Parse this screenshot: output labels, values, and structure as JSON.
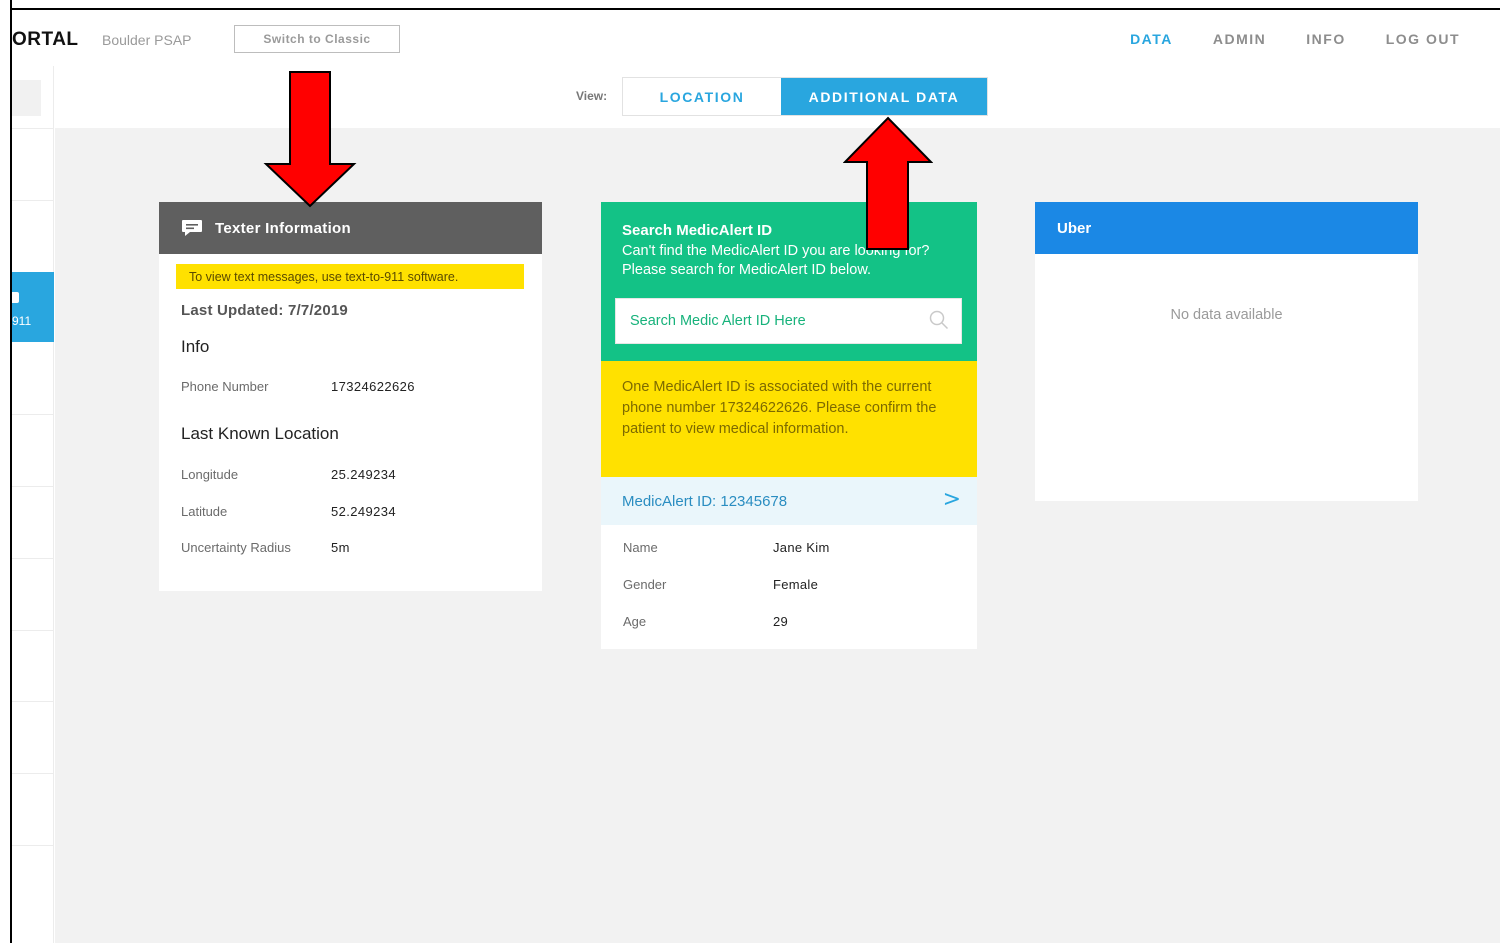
{
  "header": {
    "brand": "ORTAL",
    "psap_name": "Boulder PSAP",
    "switch_button": "Switch to Classic",
    "nav": [
      {
        "label": "DATA",
        "active": true
      },
      {
        "label": "ADMIN",
        "active": false
      },
      {
        "label": "INFO",
        "active": false
      },
      {
        "label": "LOG OUT",
        "active": false
      }
    ]
  },
  "sidebar": {
    "active_item_label": "911"
  },
  "view": {
    "label": "View:",
    "tabs": [
      {
        "label": "LOCATION",
        "active": false
      },
      {
        "label": "ADDITIONAL DATA",
        "active": true
      }
    ]
  },
  "texter": {
    "title": "Texter Information",
    "notice": "To view text messages, use text-to-911 software.",
    "last_updated": "Last Updated: 7/7/2019",
    "info_title": "Info",
    "phone_label": "Phone Number",
    "phone_value": "17324622626",
    "location_title": "Last Known Location",
    "longitude_label": "Longitude",
    "longitude_value": "25.249234",
    "latitude_label": "Latitude",
    "latitude_value": "52.249234",
    "radius_label": "Uncertainty Radius",
    "radius_value": "5m"
  },
  "medicalert": {
    "title": "Search MedicAlert ID",
    "description": "Can't find the MedicAlert ID you are looking for? Please search for MedicAlert ID below.",
    "search_placeholder": "Search Medic Alert ID Here",
    "warning": "One MedicAlert ID is associated with the current phone number 17324622626. Please confirm the patient to view medical information.",
    "id_text": "MedicAlert ID: 12345678",
    "chevron": ">",
    "name_label": "Name",
    "name_value": "Jane Kim",
    "gender_label": "Gender",
    "gender_value": "Female",
    "age_label": "Age",
    "age_value": "29"
  },
  "uber": {
    "title": "Uber",
    "empty_text": "No data available"
  },
  "colors": {
    "accent_blue": "#29a6df",
    "texter_header": "#5f5f5f",
    "medic_green": "#13c286",
    "highlight_yellow": "#ffe100",
    "uber_blue": "#1b88e5",
    "annotation_arrow": "#ff0000"
  },
  "icons": {
    "texter_header_icon": "chat-icon",
    "search_icon": "search-icon",
    "annotation": "red-arrow-icon"
  }
}
